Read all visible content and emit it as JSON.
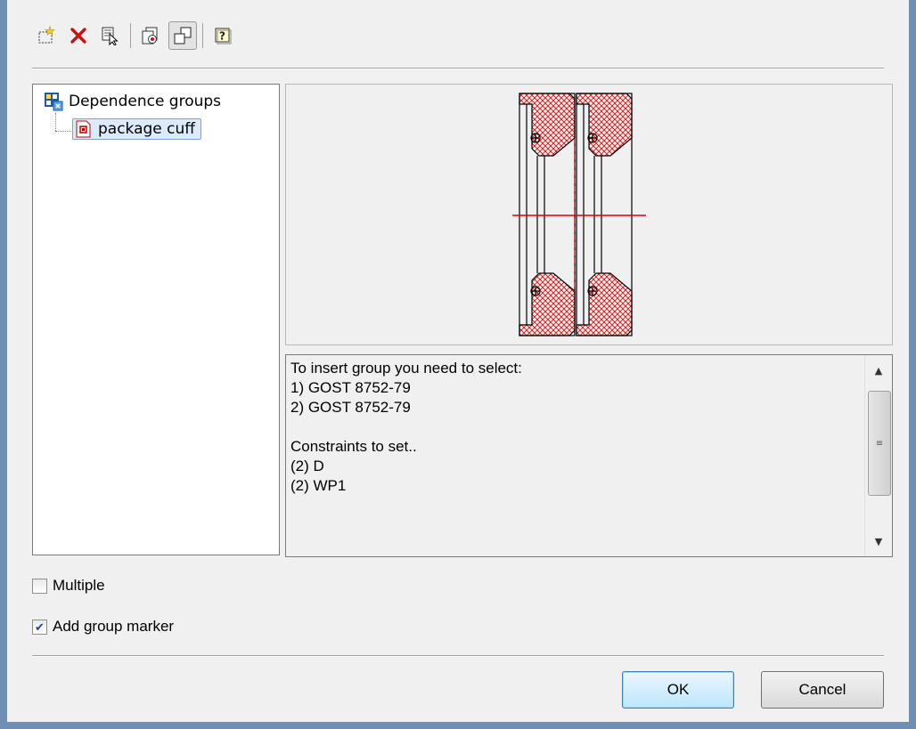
{
  "toolbar": {
    "buttons": [
      {
        "icon": "new-group-icon"
      },
      {
        "icon": "delete-icon"
      },
      {
        "icon": "select-objects-icon"
      },
      {
        "icon": "insert-group-icon"
      },
      {
        "icon": "preview-toggle-icon",
        "pressed": true
      },
      {
        "icon": "help-icon"
      }
    ]
  },
  "tree": {
    "root_label": "Dependence groups",
    "child_label": "package cuff"
  },
  "description": {
    "lines": [
      "To insert group you need to select:",
      "1) GOST 8752-79",
      "2) GOST 8752-79",
      "",
      "Constraints to set..",
      "(2) D",
      "(2) WP1"
    ]
  },
  "options": {
    "multiple_label": "Multiple",
    "multiple_checked": false,
    "marker_label": "Add group marker",
    "marker_checked": true
  },
  "footer": {
    "ok_label": "OK",
    "cancel_label": "Cancel"
  },
  "colors": {
    "accent": "#3c7fb1",
    "drawing": "#e00000"
  }
}
